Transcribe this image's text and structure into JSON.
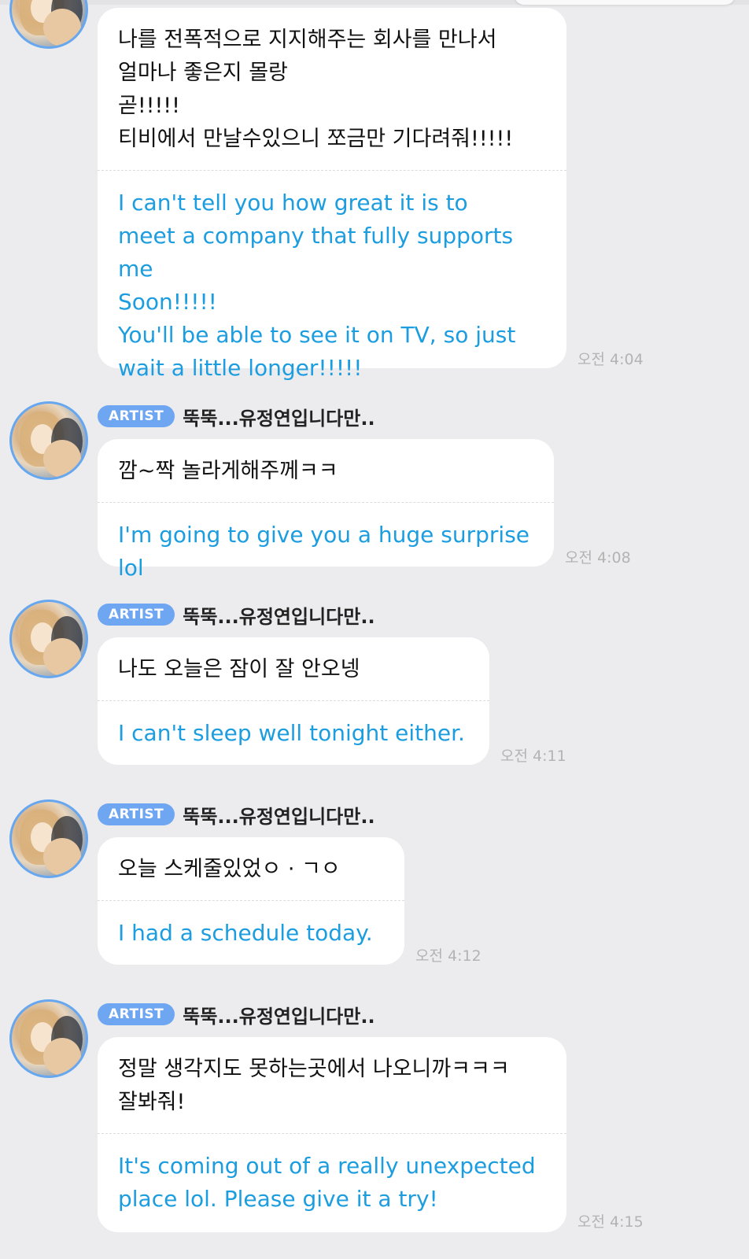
{
  "messages": [
    {
      "badge": "",
      "name": "",
      "korean": "나를 전폭적으로 지지해주는 회사를 만나서\n얼마나 좋은지 몰랑\n곧!!!!!\n티비에서 만날수있으니 쪼금만 기다려줘!!!!!",
      "english": "I can't tell you how great it is to\nmeet a company that fully supports me\nSoon!!!!!\nYou'll be able to see it on TV, so just\nwait a little longer!!!!!",
      "time": "오전 4:04"
    },
    {
      "badge": "ARTIST",
      "name": "뚝뚝...유정연입니다만..",
      "korean": "깜~짝 놀라게해주께ㅋㅋ",
      "english": "I'm going to give you a huge surprise lol",
      "time": "오전 4:08"
    },
    {
      "badge": "ARTIST",
      "name": "뚝뚝...유정연입니다만..",
      "korean": "나도 오늘은 잠이 잘 안오넹",
      "english": "I can't sleep well tonight either.",
      "time": "오전 4:11"
    },
    {
      "badge": "ARTIST",
      "name": "뚝뚝...유정연입니다만..",
      "korean": "오늘 스케줄있었ㅇ · ㄱㅇ",
      "english": "I had a schedule today.",
      "time": "오전 4:12"
    },
    {
      "badge": "ARTIST",
      "name": "뚝뚝...유정연입니다만..",
      "korean": "정말 생각지도 못하는곳에서 나오니까ㅋㅋㅋ\n잘봐줘!",
      "english": "It's coming out of a really unexpected\nplace lol. Please give it a try!",
      "time": "오전 4:15"
    }
  ]
}
